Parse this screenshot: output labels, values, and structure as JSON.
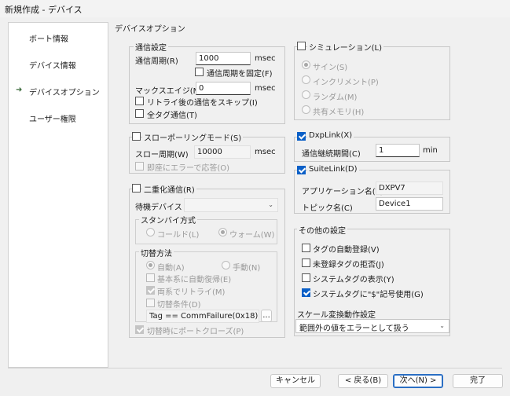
{
  "window": {
    "title": "新規作成 - デバイス"
  },
  "sidebar": {
    "items": [
      {
        "label": "ボート情報"
      },
      {
        "label": "デバイス情報"
      },
      {
        "label": "デバイスオプション"
      },
      {
        "label": "ユーザー権限"
      }
    ]
  },
  "page_title": "デバイスオプション",
  "comm": {
    "legend": "通信設定",
    "period_label": "通信周期(R)",
    "period_value": "1000",
    "period_unit": "msec",
    "fix_period_label": "通信周期を固定(F)",
    "max_age_label": "マックスエイジ(M)",
    "max_age_value": "0",
    "max_age_unit": "msec",
    "skip_retry_label": "リトライ後の通信をスキップ(I)",
    "all_tags_label": "全タグ通信(T)"
  },
  "slow_poll": {
    "legend": "スローポーリングモード(S)",
    "period_label": "スロー周期(W)",
    "period_value": "10000",
    "unit": "msec",
    "immediate_error_label": "即座にエラーで応答(O)"
  },
  "redundancy": {
    "legend": "二重化通信(R)",
    "standby_device_label": "待機デバイス",
    "standby_device_value": "",
    "standby_method_legend": "スタンバイ方式",
    "cold_label": "コールド(L)",
    "warm_label": "ウォーム(W)",
    "switch_legend": "切替方法",
    "auto_label": "自動(A)",
    "manual_label": "手動(N)",
    "auto_recover_label": "基本系に自動復帰(E)",
    "retry_both_label": "両系でリトライ(M)",
    "switch_condition_label": "切替条件(D)",
    "condition_value": "Tag == CommFailure(0x18)",
    "condition_button": "...",
    "port_close_label": "切替時にポートクローズ(P)"
  },
  "simulation": {
    "legend": "シミュレーション(L)",
    "sine_label": "サイン(S)",
    "increment_label": "インクリメント(P)",
    "random_label": "ランダム(M)",
    "shared_memory_label": "共有メモリ(H)"
  },
  "dxplink": {
    "legend": "DxpLink(X)",
    "continue_label": "通信継続期間(C)",
    "continue_value": "1",
    "unit": "min"
  },
  "suitelink": {
    "legend": "SuiteLink(D)",
    "app_name_label": "アプリケーション名(T)",
    "app_name_value": "DXPV7",
    "topic_label": "トピック名(C)",
    "topic_value": "Device1"
  },
  "other": {
    "legend": "その他の設定",
    "auto_register_label": "タグの自動登録(V)",
    "reject_unregistered_label": "未登録タグの拒否(J)",
    "show_system_tags_label": "システムタグの表示(Y)",
    "use_dollar_label": "システムタグに\"$\"記号使用(G)",
    "scale_label": "スケール変換動作設定",
    "scale_value": "範囲外の値をエラーとして扱う"
  },
  "buttons": {
    "cancel": "キャンセル",
    "back": "< 戻る(B)",
    "next": "次へ(N) >",
    "finish": "完了"
  }
}
